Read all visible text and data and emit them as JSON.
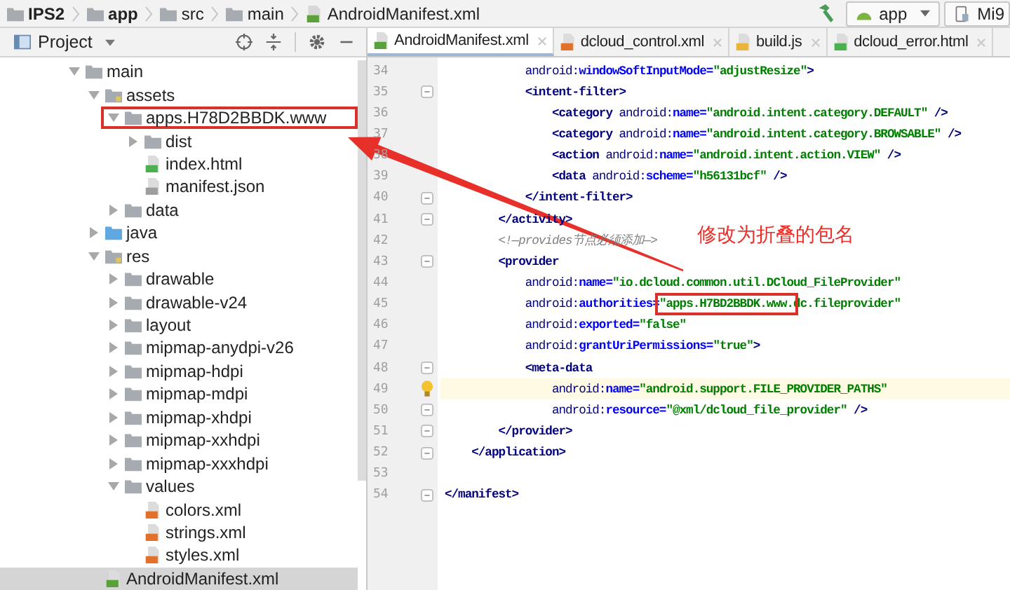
{
  "breadcrumb": [
    {
      "label": "IPS2",
      "kind": "project"
    },
    {
      "label": "app",
      "kind": "module"
    },
    {
      "label": "src",
      "kind": "folder"
    },
    {
      "label": "main",
      "kind": "folder"
    },
    {
      "label": "AndroidManifest.xml",
      "kind": "manifest"
    }
  ],
  "toolbar": {
    "run_config": "app",
    "device": "Mi9"
  },
  "project_panel": {
    "title": "Project",
    "tree": [
      {
        "label": "main",
        "kind": "folder",
        "expanded": true,
        "selected": false,
        "children": [
          {
            "label": "assets",
            "kind": "assets",
            "expanded": true,
            "selected": false,
            "children": [
              {
                "label": "apps.H78D2BBDK.www",
                "kind": "folder",
                "expanded": true,
                "selected": false,
                "annotated": true,
                "children": [
                  {
                    "label": "dist",
                    "kind": "folder",
                    "expanded": false,
                    "selected": false
                  },
                  {
                    "label": "index.html",
                    "kind": "html",
                    "selected": false
                  },
                  {
                    "label": "manifest.json",
                    "kind": "json",
                    "selected": false
                  }
                ]
              },
              {
                "label": "data",
                "kind": "folder",
                "expanded": false,
                "selected": false
              }
            ]
          },
          {
            "label": "java",
            "kind": "source",
            "expanded": false,
            "selected": false
          },
          {
            "label": "res",
            "kind": "assets",
            "expanded": true,
            "selected": false,
            "children": [
              {
                "label": "drawable",
                "kind": "folder",
                "expanded": false,
                "selected": false
              },
              {
                "label": "drawable-v24",
                "kind": "folder",
                "expanded": false,
                "selected": false
              },
              {
                "label": "layout",
                "kind": "folder",
                "expanded": false,
                "selected": false
              },
              {
                "label": "mipmap-anydpi-v26",
                "kind": "folder",
                "expanded": false,
                "selected": false
              },
              {
                "label": "mipmap-hdpi",
                "kind": "folder",
                "expanded": false,
                "selected": false
              },
              {
                "label": "mipmap-mdpi",
                "kind": "folder",
                "expanded": false,
                "selected": false
              },
              {
                "label": "mipmap-xhdpi",
                "kind": "folder",
                "expanded": false,
                "selected": false
              },
              {
                "label": "mipmap-xxhdpi",
                "kind": "folder",
                "expanded": false,
                "selected": false
              },
              {
                "label": "mipmap-xxxhdpi",
                "kind": "folder",
                "expanded": false,
                "selected": false
              },
              {
                "label": "values",
                "kind": "folder",
                "expanded": true,
                "selected": false,
                "children": [
                  {
                    "label": "colors.xml",
                    "kind": "xml",
                    "selected": false
                  },
                  {
                    "label": "strings.xml",
                    "kind": "xml",
                    "selected": false
                  },
                  {
                    "label": "styles.xml",
                    "kind": "xml",
                    "selected": false
                  }
                ]
              }
            ]
          },
          {
            "label": "AndroidManifest.xml",
            "kind": "manifest",
            "selected": true
          }
        ]
      }
    ]
  },
  "editor": {
    "tabs": [
      {
        "label": "AndroidManifest.xml",
        "kind": "manifest",
        "selected": true
      },
      {
        "label": "dcloud_control.xml",
        "kind": "xml",
        "selected": false
      },
      {
        "label": "build.js",
        "kind": "js",
        "selected": false
      },
      {
        "label": "dcloud_error.html",
        "kind": "html",
        "selected": false
      }
    ],
    "lines": [
      {
        "number": "34",
        "fold": false,
        "current": false,
        "tokens": [
          {
            "text": "            android:",
            "kind": "ns"
          },
          {
            "text": "windowSoftInputMode",
            "kind": "attr"
          },
          {
            "text": "=",
            "kind": "attr"
          },
          {
            "text": "\"adjustResize\"",
            "kind": "str"
          },
          {
            "text": ">",
            "kind": "tag"
          }
        ]
      },
      {
        "number": "35",
        "fold": true,
        "current": false,
        "tokens": [
          {
            "text": "            <intent-filter>",
            "kind": "tag"
          }
        ]
      },
      {
        "number": "36",
        "fold": false,
        "current": false,
        "tokens": [
          {
            "text": "                <category ",
            "kind": "tag"
          },
          {
            "text": "android:",
            "kind": "ns"
          },
          {
            "text": "name=",
            "kind": "attr"
          },
          {
            "text": "\"android.intent.category.DEFAULT\"",
            "kind": "str"
          },
          {
            "text": " />",
            "kind": "tag"
          }
        ]
      },
      {
        "number": "37",
        "fold": false,
        "current": false,
        "tokens": [
          {
            "text": "                <category ",
            "kind": "tag"
          },
          {
            "text": "android:",
            "kind": "ns"
          },
          {
            "text": "name=",
            "kind": "attr"
          },
          {
            "text": "\"android.intent.category.BROWSABLE\"",
            "kind": "str"
          },
          {
            "text": " />",
            "kind": "tag"
          }
        ]
      },
      {
        "number": "38",
        "fold": false,
        "current": false,
        "tokens": [
          {
            "text": "                <action ",
            "kind": "tag"
          },
          {
            "text": "android:",
            "kind": "ns"
          },
          {
            "text": "name=",
            "kind": "attr"
          },
          {
            "text": "\"android.intent.action.VIEW\"",
            "kind": "str"
          },
          {
            "text": " />",
            "kind": "tag"
          }
        ]
      },
      {
        "number": "39",
        "fold": false,
        "current": false,
        "tokens": [
          {
            "text": "                <data ",
            "kind": "tag"
          },
          {
            "text": "android:",
            "kind": "ns"
          },
          {
            "text": "scheme=",
            "kind": "attr"
          },
          {
            "text": "\"h56131bcf\"",
            "kind": "str"
          },
          {
            "text": " />",
            "kind": "tag"
          }
        ]
      },
      {
        "number": "40",
        "fold": true,
        "current": false,
        "tokens": [
          {
            "text": "            </intent-filter>",
            "kind": "tag"
          }
        ]
      },
      {
        "number": "41",
        "fold": true,
        "current": false,
        "tokens": [
          {
            "text": "        </activity>",
            "kind": "tag"
          }
        ]
      },
      {
        "number": "42",
        "fold": false,
        "current": false,
        "tokens": [
          {
            "text": "        <!—provides节点必须添加—>",
            "kind": "comment"
          }
        ]
      },
      {
        "number": "43",
        "fold": true,
        "current": false,
        "tokens": [
          {
            "text": "        <provider",
            "kind": "tag"
          }
        ]
      },
      {
        "number": "44",
        "fold": false,
        "current": false,
        "tokens": [
          {
            "text": "            android:",
            "kind": "ns"
          },
          {
            "text": "name=",
            "kind": "attr"
          },
          {
            "text": "\"io.dcloud.common.util.DCloud_FileProvider\"",
            "kind": "str"
          }
        ]
      },
      {
        "number": "45",
        "fold": false,
        "current": false,
        "tokens": [
          {
            "text": "            android:",
            "kind": "ns"
          },
          {
            "text": "authorities=",
            "kind": "attr"
          },
          {
            "text": "\"apps.H7BD2BBDK.www.",
            "kind": "str",
            "annotated": true
          },
          {
            "text": "dc.fileprovider\"",
            "kind": "str"
          }
        ]
      },
      {
        "number": "46",
        "fold": false,
        "current": false,
        "tokens": [
          {
            "text": "            android:",
            "kind": "ns"
          },
          {
            "text": "exported=",
            "kind": "attr"
          },
          {
            "text": "\"false\"",
            "kind": "str"
          }
        ]
      },
      {
        "number": "47",
        "fold": false,
        "current": false,
        "tokens": [
          {
            "text": "            android:",
            "kind": "ns"
          },
          {
            "text": "grantUriPermissions=",
            "kind": "attr"
          },
          {
            "text": "\"true\"",
            "kind": "str"
          },
          {
            "text": ">",
            "kind": "tag"
          }
        ]
      },
      {
        "number": "48",
        "fold": true,
        "current": false,
        "tokens": [
          {
            "text": "            <meta-data",
            "kind": "tag"
          }
        ]
      },
      {
        "number": "49",
        "fold": false,
        "current": true,
        "tokens": [
          {
            "text": "                android:",
            "kind": "ns"
          },
          {
            "text": "name=",
            "kind": "attr"
          },
          {
            "text": "\"android.support.FILE_PROVIDER_PATHS\"",
            "kind": "str"
          }
        ]
      },
      {
        "number": "50",
        "fold": true,
        "current": false,
        "tokens": [
          {
            "text": "                android:",
            "kind": "ns"
          },
          {
            "text": "resource=",
            "kind": "attr"
          },
          {
            "text": "\"@xml/dcloud_file_provider\"",
            "kind": "str"
          },
          {
            "text": " />",
            "kind": "tag"
          }
        ]
      },
      {
        "number": "51",
        "fold": true,
        "current": false,
        "tokens": [
          {
            "text": "        </provider>",
            "kind": "tag"
          }
        ]
      },
      {
        "number": "52",
        "fold": true,
        "current": false,
        "tokens": [
          {
            "text": "    </application>",
            "kind": "tag"
          }
        ]
      },
      {
        "number": "53",
        "fold": false,
        "current": false
      },
      {
        "number": "54",
        "fold": true,
        "current": false,
        "tokens": [
          {
            "text": "</manifest>",
            "kind": "tag"
          }
        ]
      }
    ]
  },
  "annotation": {
    "note": "修改为折叠的包名"
  }
}
